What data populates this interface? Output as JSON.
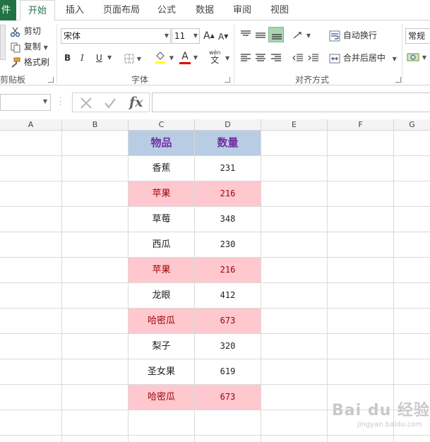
{
  "tabs": {
    "file": "件",
    "home": "开始",
    "insert": "插入",
    "layout": "页面布局",
    "formulas": "公式",
    "data": "数据",
    "review": "审阅",
    "view": "视图"
  },
  "clipboard": {
    "cut": "剪切",
    "copy": "复制",
    "painter": "格式刷",
    "label": "剪贴板"
  },
  "font": {
    "name": "宋体",
    "size": "11",
    "bold": "B",
    "italic": "I",
    "underline": "U",
    "grow": "A",
    "shrink": "A",
    "color_glyph": "A",
    "phonetic_top": "wén",
    "phonetic_bottom": "文",
    "label": "字体"
  },
  "alignment": {
    "wrap": "自动换行",
    "merge": "合并后居中",
    "label": "对齐方式"
  },
  "number": {
    "format": "常规"
  },
  "formula_bar": {
    "fx": "fx"
  },
  "columns": [
    "A",
    "B",
    "C",
    "D",
    "E",
    "F",
    "G"
  ],
  "table": {
    "headers": [
      "物品",
      "数量"
    ],
    "rows": [
      {
        "item": "香蕉",
        "qty": "231",
        "highlight": false
      },
      {
        "item": "苹果",
        "qty": "216",
        "highlight": true
      },
      {
        "item": "草莓",
        "qty": "348",
        "highlight": false
      },
      {
        "item": "西瓜",
        "qty": "230",
        "highlight": false
      },
      {
        "item": "苹果",
        "qty": "216",
        "highlight": true
      },
      {
        "item": "龙眼",
        "qty": "412",
        "highlight": false
      },
      {
        "item": "哈密瓜",
        "qty": "673",
        "highlight": true
      },
      {
        "item": "梨子",
        "qty": "320",
        "highlight": false
      },
      {
        "item": "圣女果",
        "qty": "619",
        "highlight": false
      },
      {
        "item": "哈密瓜",
        "qty": "673",
        "highlight": true
      }
    ]
  },
  "colors": {
    "accent": "#217346",
    "header_fill": "#b8cce4",
    "header_text": "#7030a0",
    "dup_fill": "#ffc7ce",
    "dup_text": "#9c0006"
  },
  "watermark": {
    "text": "Bai du 经验",
    "url": "jingyan.baidu.com"
  }
}
